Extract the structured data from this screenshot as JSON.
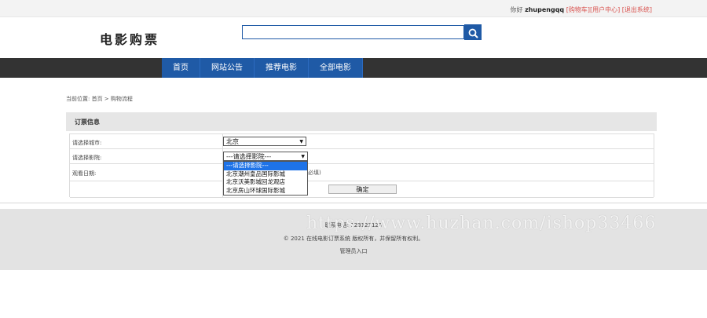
{
  "topbar": {
    "greeting": "你好",
    "username": "zhupengqq",
    "links": [
      "[购物车]",
      "[用户中心]",
      "[退出系统]"
    ]
  },
  "logo": "电影购票",
  "search": {
    "value": "",
    "placeholder": ""
  },
  "nav": [
    "首页",
    "网站公告",
    "推荐电影",
    "全部电影"
  ],
  "breadcrumb": "当前位置: 首页 > 购物流程",
  "panel": {
    "title": "订票信息"
  },
  "form": {
    "city_label": "请选择城市:",
    "city_value": "北京",
    "cinema_label": "请选择影院:",
    "cinema_value": "---请选择影院---",
    "cinema_options": [
      "---请选择影院---",
      "北京潮州皇品国际影城",
      "北京沃美影城回龙观店",
      "北京房山环球国际影城"
    ],
    "date_label": "观看日期:",
    "required_note": "必填)",
    "confirm_label": "确定"
  },
  "footer": {
    "contact": "联系电话: 123123123",
    "copyright": "© 2021 在线电影订票系统 版权所有，并保留所有权利。",
    "admin_link": "管理员入口"
  },
  "watermark": "https://www.huzhan.com/ishop33466",
  "colors": {
    "accent": "#1f5aa6",
    "nav_bg": "#333333",
    "link_red": "#d9534f",
    "highlight": "#1e73e8"
  }
}
